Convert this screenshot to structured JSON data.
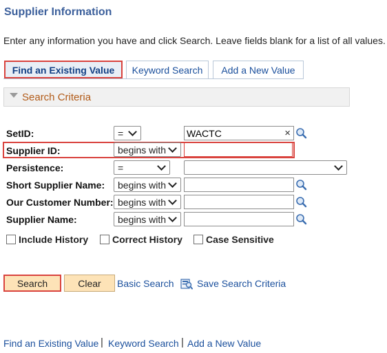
{
  "page": {
    "title": "Supplier Information",
    "instructions": "Enter any information you have and click Search. Leave fields blank for a list of all values."
  },
  "tabs": [
    {
      "label": "Find an Existing Value",
      "active": true
    },
    {
      "label": "Keyword Search",
      "active": false
    },
    {
      "label": "Add a New Value",
      "active": false
    }
  ],
  "search_criteria": {
    "heading": "Search Criteria",
    "fields": [
      {
        "label": "SetID:",
        "operator": "=",
        "value": "WACTC"
      },
      {
        "label": "Supplier ID:",
        "operator": "begins with",
        "value": ""
      },
      {
        "label": "Persistence:",
        "operator": "=",
        "value": ""
      },
      {
        "label": "Short Supplier Name:",
        "operator": "begins with",
        "value": ""
      },
      {
        "label": "Our Customer Number:",
        "operator": "begins with",
        "value": ""
      },
      {
        "label": "Supplier Name:",
        "operator": "begins with",
        "value": ""
      }
    ],
    "clear_glyph": "×",
    "checkboxes": [
      {
        "label": "Include History",
        "checked": false
      },
      {
        "label": "Correct History",
        "checked": false
      },
      {
        "label": "Case Sensitive",
        "checked": false
      }
    ]
  },
  "actions": {
    "search": "Search",
    "clear": "Clear",
    "basic_search": "Basic Search",
    "save_search": "Save Search Criteria"
  },
  "footer_links": [
    "Find an Existing Value",
    "Keyword Search",
    "Add a New Value"
  ],
  "footer_separator": "|",
  "colors": {
    "title": "#3b5f9b",
    "link": "#1a4f9c",
    "highlight": "#d9423d",
    "group_label": "#b15a17",
    "button_bg": "#fde3b7"
  },
  "icons": {
    "lookup": "magnifier-icon",
    "save": "save-search-icon",
    "groupbox": "collapse-triangle-icon"
  }
}
